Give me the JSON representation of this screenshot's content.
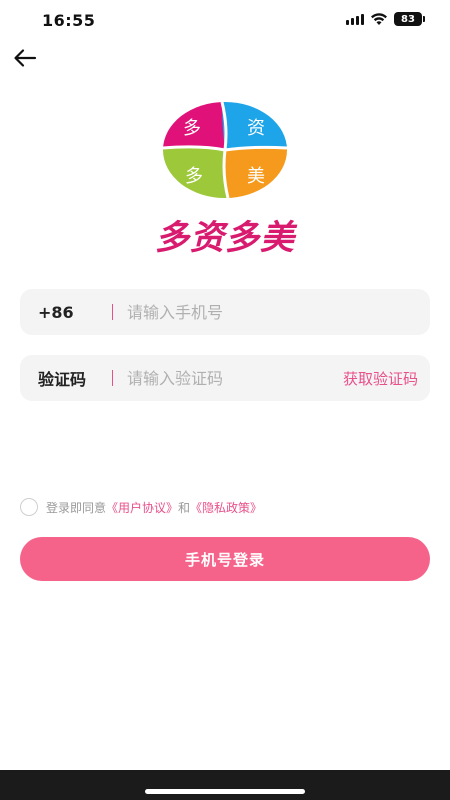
{
  "status_bar": {
    "time": "16:55",
    "battery": "83",
    "icons": [
      "signal-icon",
      "wifi-icon",
      "battery-icon"
    ]
  },
  "nav": {
    "back_icon": "arrow-left-icon"
  },
  "logo": {
    "quadrants": [
      {
        "char": "多",
        "color": "#e0127a"
      },
      {
        "char": "资",
        "color": "#1ea5e9"
      },
      {
        "char": "多",
        "color": "#9cc83a"
      },
      {
        "char": "美",
        "color": "#f59a1c"
      }
    ],
    "text": "多资多美",
    "text_color": "#d81b6e"
  },
  "phone_field": {
    "prefix": "+86",
    "placeholder": "请输入手机号"
  },
  "code_field": {
    "label": "验证码",
    "placeholder": "请输入验证码",
    "action": "获取验证码"
  },
  "agreement": {
    "prefix": "登录即同意",
    "user_agreement": "《用户协议》",
    "and": "和",
    "privacy_policy": "《隐私政策》"
  },
  "login_button": {
    "label": "手机号登录",
    "color": "#f5628a"
  },
  "accent_color": "#e8508a"
}
